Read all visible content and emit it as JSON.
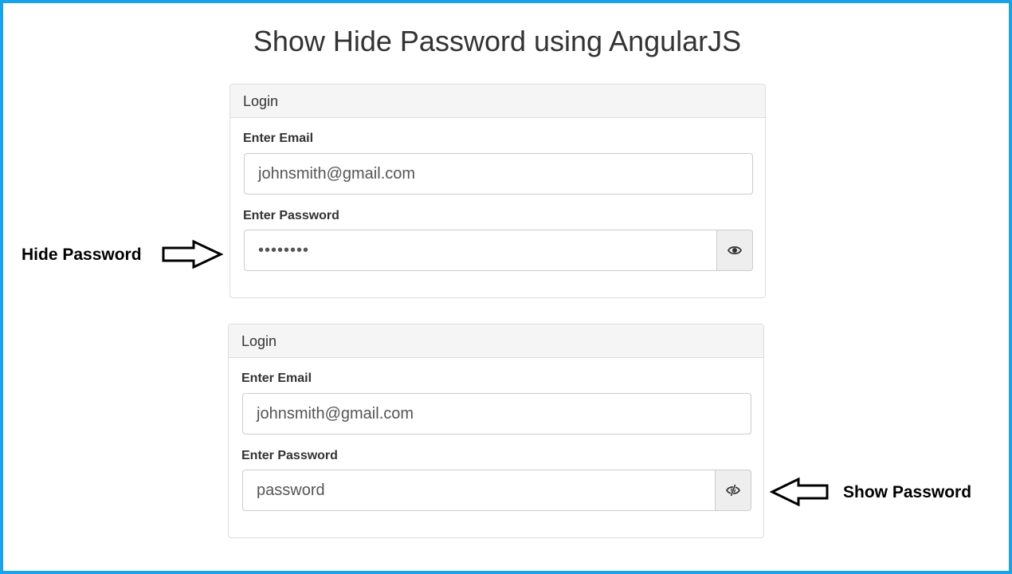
{
  "page": {
    "title": "Show Hide Password using AngularJS"
  },
  "panels": [
    {
      "heading": "Login",
      "email_label": "Enter Email",
      "email_value": "johnsmith@gmail.com",
      "password_label": "Enter Password",
      "password_value": "••••••••",
      "toggle_icon": "eye-icon"
    },
    {
      "heading": "Login",
      "email_label": "Enter Email",
      "email_value": "johnsmith@gmail.com",
      "password_label": "Enter Password",
      "password_value": "password",
      "toggle_icon": "eye-slash-icon"
    }
  ],
  "annotations": {
    "hide_label": "Hide Password",
    "show_label": "Show Password"
  },
  "colors": {
    "frame_border": "#1aa3e8",
    "panel_heading_bg": "#f5f5f5",
    "addon_bg": "#eeeeee"
  }
}
